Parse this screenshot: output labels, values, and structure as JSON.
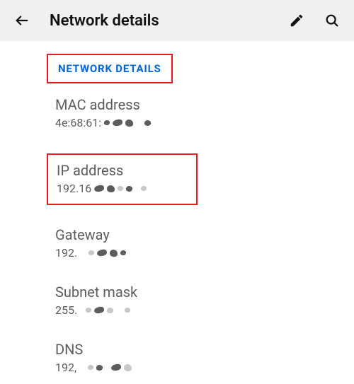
{
  "header": {
    "title": "Network details"
  },
  "section": {
    "title": "NETWORK DETAILS"
  },
  "items": [
    {
      "label": "MAC address",
      "value": "4e:68:61:",
      "highlighted": false
    },
    {
      "label": "IP address",
      "value": "192.16",
      "highlighted": true
    },
    {
      "label": "Gateway",
      "value": "192.",
      "highlighted": false
    },
    {
      "label": "Subnet mask",
      "value": "255.",
      "highlighted": false
    },
    {
      "label": "DNS",
      "value": "192,",
      "highlighted": false
    }
  ]
}
